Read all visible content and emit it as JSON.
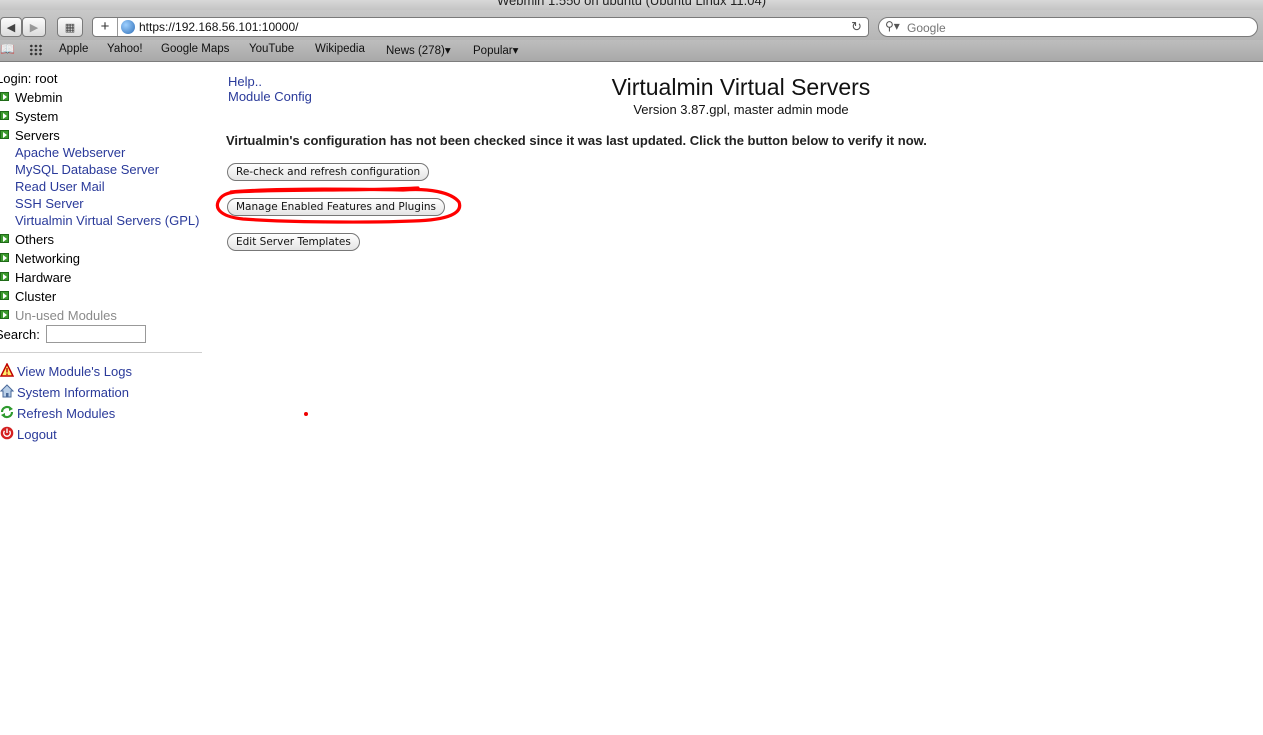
{
  "window": {
    "title": "Webmin 1.550 on ubuntu (Ubuntu Linux 11.04)"
  },
  "browser": {
    "url": "https://192.168.56.101:10000/",
    "search_placeholder": "Google",
    "bookmarks": [
      "Apple",
      "Yahoo!",
      "Google Maps",
      "YouTube",
      "Wikipedia",
      "News (278)",
      "Popular"
    ]
  },
  "sidebar": {
    "login": "Login: root",
    "categories": [
      {
        "label": "Webmin"
      },
      {
        "label": "System"
      },
      {
        "label": "Servers"
      },
      {
        "label": "Others"
      },
      {
        "label": "Networking"
      },
      {
        "label": "Hardware"
      },
      {
        "label": "Cluster"
      },
      {
        "label": "Un-used Modules"
      }
    ],
    "servers_items": [
      "Apache Webserver",
      "MySQL Database Server",
      "Read User Mail",
      "SSH Server",
      "Virtualmin Virtual Servers (GPL)"
    ],
    "search_label": "Search:",
    "links": [
      {
        "label": "View Module's Logs",
        "icon": "warning-icon"
      },
      {
        "label": "System Information",
        "icon": "house-icon"
      },
      {
        "label": "Refresh Modules",
        "icon": "refresh-icon"
      },
      {
        "label": "Logout",
        "icon": "power-icon"
      }
    ]
  },
  "main": {
    "help_link": "Help..",
    "config_link": "Module Config",
    "title": "Virtualmin Virtual Servers",
    "version": "Version 3.87.gpl, master admin mode",
    "notice": "Virtualmin's configuration has not been checked since it was last updated. Click the button below to verify it now.",
    "buttons": [
      "Re-check and refresh configuration",
      "Manage Enabled Features and Plugins",
      "Edit Server Templates"
    ]
  },
  "colors": {
    "link": "#2a3a9a",
    "annotation": "#ff0000",
    "category_expander": "#3c9a2e"
  }
}
